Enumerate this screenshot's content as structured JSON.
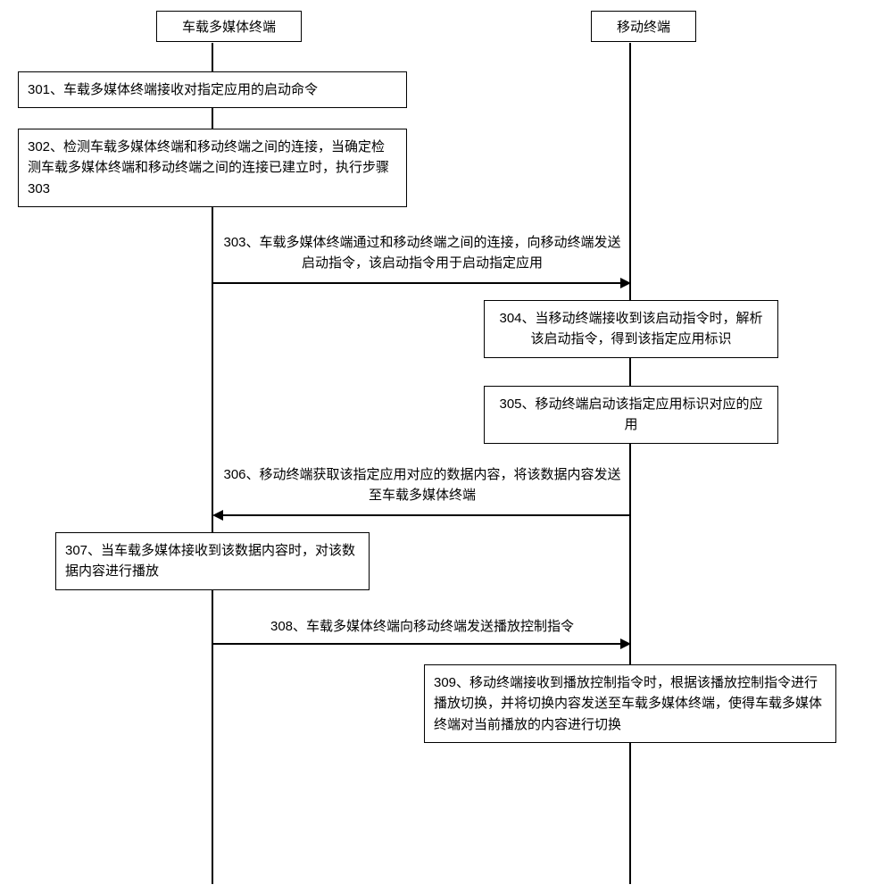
{
  "lanes": {
    "left": "车载多媒体终端",
    "right": "移动终端"
  },
  "steps": {
    "s301": "301、车载多媒体终端接收对指定应用的启动命令",
    "s302": "302、检测车载多媒体终端和移动终端之间的连接，当确定检测车载多媒体终端和移动终端之间的连接已建立时，执行步骤303",
    "s303": "303、车载多媒体终端通过和移动终端之间的连接，向移动终端发送启动指令，该启动指令用于启动指定应用",
    "s304": "304、当移动终端接收到该启动指令时，解析该启动指令，得到该指定应用标识",
    "s305": "305、移动终端启动该指定应用标识对应的应用",
    "s306": "306、移动终端获取该指定应用对应的数据内容，将该数据内容发送至车载多媒体终端",
    "s307": "307、当车载多媒体接收到该数据内容时，对该数据内容进行播放",
    "s308": "308、车载多媒体终端向移动终端发送播放控制指令",
    "s309": "309、移动终端接收到播放控制指令时，根据该播放控制指令进行播放切换，并将切换内容发送至车载多媒体终端，使得车载多媒体终端对当前播放的内容进行切换"
  },
  "chart_data": {
    "type": "sequence",
    "participants": [
      "车载多媒体终端",
      "移动终端"
    ],
    "events": [
      {
        "id": "301",
        "at": "车载多媒体终端",
        "kind": "activity",
        "text": "车载多媒体终端接收对指定应用的启动命令"
      },
      {
        "id": "302",
        "at": "车载多媒体终端",
        "kind": "activity",
        "text": "检测车载多媒体终端和移动终端之间的连接，当确定检测车载多媒体终端和移动终端之间的连接已建立时，执行步骤303"
      },
      {
        "id": "303",
        "from": "车载多媒体终端",
        "to": "移动终端",
        "kind": "message",
        "text": "车载多媒体终端通过和移动终端之间的连接，向移动终端发送启动指令，该启动指令用于启动指定应用"
      },
      {
        "id": "304",
        "at": "移动终端",
        "kind": "activity",
        "text": "当移动终端接收到该启动指令时，解析该启动指令，得到该指定应用标识"
      },
      {
        "id": "305",
        "at": "移动终端",
        "kind": "activity",
        "text": "移动终端启动该指定应用标识对应的应用"
      },
      {
        "id": "306",
        "from": "移动终端",
        "to": "车载多媒体终端",
        "kind": "message",
        "text": "移动终端获取该指定应用对应的数据内容，将该数据内容发送至车载多媒体终端"
      },
      {
        "id": "307",
        "at": "车载多媒体终端",
        "kind": "activity",
        "text": "当车载多媒体接收到该数据内容时，对该数据内容进行播放"
      },
      {
        "id": "308",
        "from": "车载多媒体终端",
        "to": "移动终端",
        "kind": "message",
        "text": "车载多媒体终端向移动终端发送播放控制指令"
      },
      {
        "id": "309",
        "at": "移动终端",
        "kind": "activity",
        "text": "移动终端接收到播放控制指令时，根据该播放控制指令进行播放切换，并将切换内容发送至车载多媒体终端，使得车载多媒体终端对当前播放的内容进行切换"
      }
    ]
  }
}
